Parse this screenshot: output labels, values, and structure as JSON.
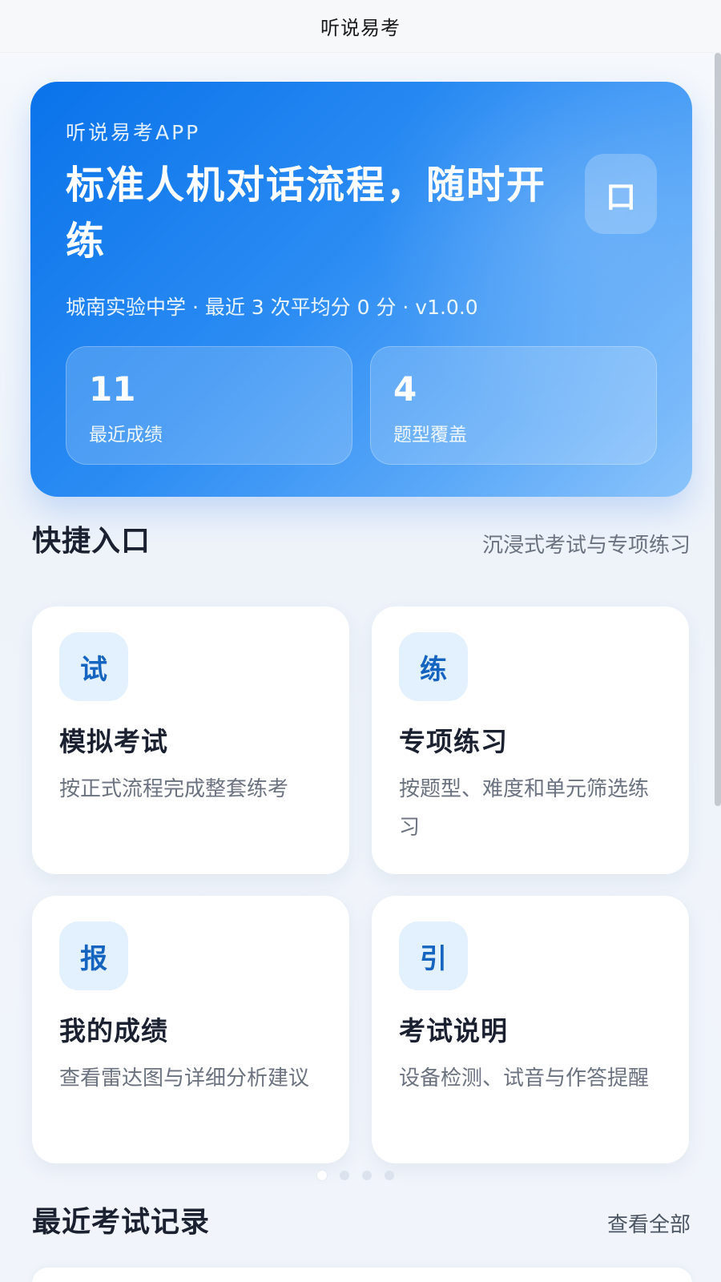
{
  "navbar": {
    "title": "听说易考"
  },
  "hero": {
    "kicker": "听说易考APP",
    "title": "标准人机对话流程，随时开练",
    "badge": "口",
    "meta": "城南实验中学 · 最近 3 次平均分 0 分 · v1.0.0",
    "stats": [
      {
        "value": "11",
        "label": "最近成绩"
      },
      {
        "value": "4",
        "label": "题型覆盖"
      }
    ]
  },
  "quick": {
    "title": "快捷入口",
    "subtitle": "沉浸式考试与专项练习",
    "cards": [
      {
        "icon": "试",
        "title": "模拟考试",
        "desc": "按正式流程完成整套练考"
      },
      {
        "icon": "练",
        "title": "专项练习",
        "desc": "按题型、难度和单元筛选练习"
      },
      {
        "icon": "报",
        "title": "我的成绩",
        "desc": "查看雷达图与详细分析建议"
      },
      {
        "icon": "引",
        "title": "考试说明",
        "desc": "设备检测、试音与作答提醒"
      }
    ]
  },
  "pager": {
    "count": 4,
    "active": 0
  },
  "recent": {
    "title": "最近考试记录",
    "link": "查看全部"
  },
  "colors": {
    "accent": "#0a73ea",
    "icon_bg": "#e3f0fd",
    "icon_fg": "#1565c0"
  }
}
